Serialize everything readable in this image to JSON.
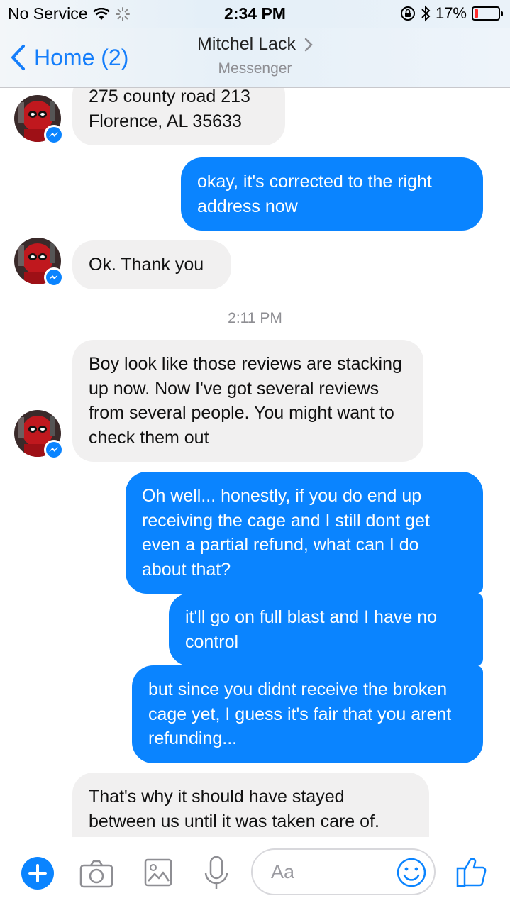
{
  "status_bar": {
    "carrier": "No Service",
    "time": "2:34 PM",
    "battery": "17%",
    "battery_level": 0.17,
    "icons": [
      "wifi-icon",
      "activity-spinner-icon",
      "rotation-lock-icon",
      "bluetooth-icon",
      "battery-icon"
    ]
  },
  "nav": {
    "back_label": "Home (2)",
    "title": "Mitchel Lack",
    "subtitle": "Messenger"
  },
  "messages": {
    "m1": "275 county road 213 Florence, AL 35633",
    "m2": "okay, it's corrected to the right address now",
    "m3": "Ok. Thank you",
    "timestamp": "2:11 PM",
    "m4": "Boy look like those reviews are stacking up now. Now I've got several reviews from several people. You might want to check them out",
    "m5": "Oh well... honestly, if you do end up receiving the cage and I still dont get even a partial refund, what can I do about that?",
    "m6": "it'll go on full blast and I have no control",
    "m7": "but since you didnt receive the broken cage yet, I guess it's fair that you arent refunding...",
    "m8": "That's why it should have stayed between us until it was taken care of."
  },
  "composer": {
    "placeholder": "Aa",
    "icons": [
      "plus-icon",
      "camera-icon",
      "gallery-icon",
      "microphone-icon",
      "emoji-icon",
      "like-icon"
    ]
  },
  "colors": {
    "accent": "#0a84ff",
    "incoming_bubble": "#f1f0f0",
    "nav_tint": "#157efb"
  }
}
